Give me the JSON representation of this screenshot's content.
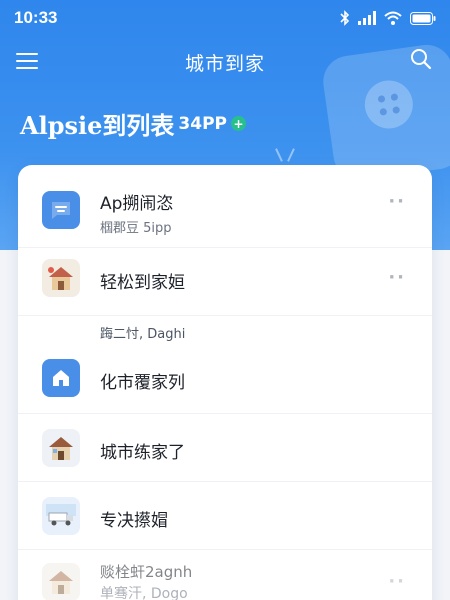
{
  "status_bar": {
    "time": "10:33"
  },
  "header": {
    "title": "城市到家"
  },
  "hero": {
    "headline": "Alpsie到列表",
    "suffix": "34PP",
    "plus": "+"
  },
  "list": {
    "items": [
      {
        "title": "Ap搠闹恣",
        "subtitle": "椢郡豆 5ipp",
        "icon": "message-icon"
      },
      {
        "title": "轻松到家姮",
        "subtitle": "",
        "icon": "house-illustration-icon"
      },
      {
        "title": "化市覆家列",
        "subtitle": "",
        "icon": "home-icon"
      },
      {
        "title": "城市练家了",
        "subtitle": "",
        "icon": "house-illustration-icon"
      },
      {
        "title": "专决攃媢",
        "subtitle": "",
        "icon": "truck-illustration-icon"
      },
      {
        "title": "赕栓虷2agnh",
        "subtitle": "单骞汗, Dogo",
        "icon": "house-illustration-icon"
      }
    ],
    "section_label": "踇二忖, Daghi",
    "more_glyph": "··"
  },
  "colors": {
    "primary": "#2f86ec",
    "accent_green": "#27c08d",
    "icon_blue": "#4a8fe7"
  }
}
